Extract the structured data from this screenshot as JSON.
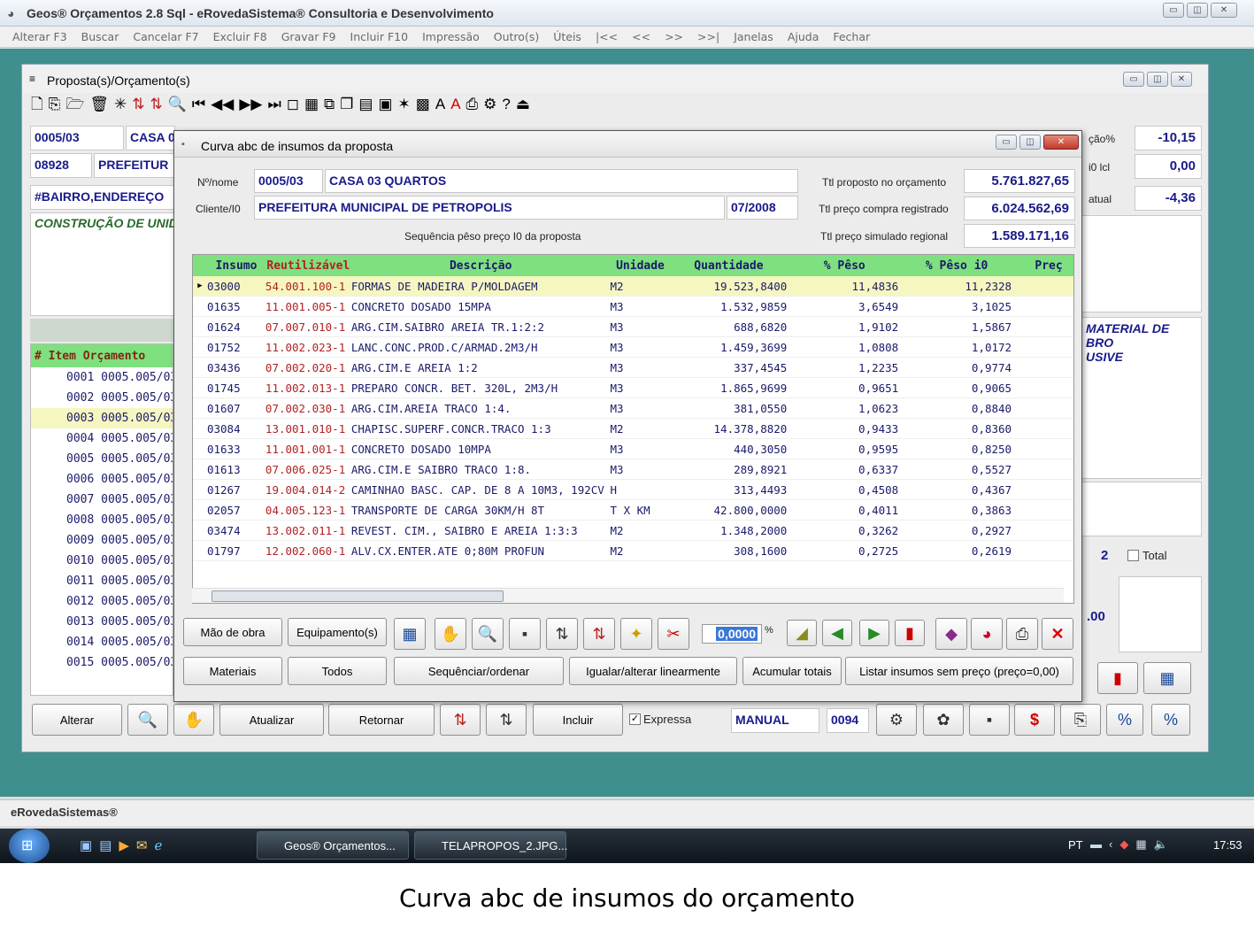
{
  "app": {
    "title": "Geos® Orçamentos 2.8 Sql - eRovedaSistema® Consultoria e Desenvolvimento"
  },
  "menu": [
    "Alterar F3",
    "Buscar",
    "Cancelar F7",
    "Excluir F8",
    "Gravar F9",
    "Incluir F10",
    "Impressão",
    "Outro(s)",
    "Úteis",
    "|<<",
    "<<",
    ">>",
    ">>|",
    "Janelas",
    "Ajuda",
    "Fechar"
  ],
  "proposal": {
    "title": "Proposta(s)/Orçamento(s)",
    "code": "0005/03",
    "name": "CASA 0",
    "client_code": "08928",
    "client_name": "PREFEITUR",
    "address": "#BAIRRO,ENDEREÇO",
    "construction": "CONSTRUÇÃO DE UNID",
    "right_labels": [
      "ção%",
      "i0 lcl",
      "atual"
    ],
    "right_values": [
      "-10,15",
      "0,00",
      "-4,36"
    ],
    "note": "MATERIAL DE\nBRO\nUSIVE",
    "count": "2",
    "total_label": "Total",
    "partial_value": ".00",
    "items_header": "# Item Orçamento",
    "items": [
      {
        "item": "0001",
        "orc": "0005.005/03"
      },
      {
        "item": "0002",
        "orc": "0005.005/03"
      },
      {
        "item": "0003",
        "orc": "0005.005/03"
      },
      {
        "item": "0004",
        "orc": "0005.005/03"
      },
      {
        "item": "0005",
        "orc": "0005.005/03"
      },
      {
        "item": "0006",
        "orc": "0005.005/03"
      },
      {
        "item": "0007",
        "orc": "0005.005/03"
      },
      {
        "item": "0008",
        "orc": "0005.005/03"
      },
      {
        "item": "0009",
        "orc": "0005.005/03"
      },
      {
        "item": "0010",
        "orc": "0005.005/03"
      },
      {
        "item": "0011",
        "orc": "0005.005/03"
      },
      {
        "item": "0012",
        "orc": "0005.005/03"
      },
      {
        "item": "0013",
        "orc": "0005.005/03"
      },
      {
        "item": "0014",
        "orc": "0005.005/03"
      },
      {
        "item": "0015",
        "orc": "0005.005/03"
      }
    ],
    "bottom": {
      "alterar": "Alterar",
      "atualizar": "Atualizar",
      "retornar": "Retornar",
      "incluir": "Incluir",
      "expressa": "Expressa",
      "manual": "MANUAL",
      "num": "0094"
    }
  },
  "dialog": {
    "title": "Curva abc de insumos da proposta",
    "nome_label": "Nº/nome",
    "code": "0005/03",
    "name": "CASA 03 QUARTOS",
    "cliente_label": "Cliente/I0",
    "client": "PREFEITURA MUNICIPAL DE PETROPOLIS",
    "date": "07/2008",
    "sequence_label": "Sequência pêso preço I0 da proposta",
    "totals": [
      {
        "label": "Ttl proposto no orçamento",
        "value": "5.761.827,65"
      },
      {
        "label": "Ttl preço compra registrado",
        "value": "6.024.562,69"
      },
      {
        "label": "Ttl preço simulado regional",
        "value": "1.589.171,16"
      }
    ],
    "columns": [
      "Insumo",
      "Reutilizável",
      "Descrição",
      "Unidade",
      "Quantidade",
      "% Pêso",
      "% Pêso i0",
      "Preç"
    ],
    "rows": [
      [
        "03000",
        "54.001.100-1",
        "FORMAS DE MADEIRA P/MOLDAGEM",
        "M2",
        "19.523,8400",
        "11,4836",
        "11,2328"
      ],
      [
        "01635",
        "11.001.005-1",
        "CONCRETO DOSADO 15MPA",
        "M3",
        "1.532,9859",
        "3,6549",
        "3,1025"
      ],
      [
        "01624",
        "07.007.010-1",
        "ARG.CIM.SAIBRO AREIA TR.1:2:2",
        "M3",
        "688,6820",
        "1,9102",
        "1,5867"
      ],
      [
        "01752",
        "11.002.023-1",
        "LANC.CONC.PROD.C/ARMAD.2M3/H",
        "M3",
        "1.459,3699",
        "1,0808",
        "1,0172"
      ],
      [
        "03436",
        "07.002.020-1",
        "ARG.CIM.E AREIA 1:2",
        "M3",
        "337,4545",
        "1,2235",
        "0,9774"
      ],
      [
        "01745",
        "11.002.013-1",
        "PREPARO CONCR. BET. 320L, 2M3/H",
        "M3",
        "1.865,9699",
        "0,9651",
        "0,9065"
      ],
      [
        "01607",
        "07.002.030-1",
        "ARG.CIM.AREIA TRACO 1:4.",
        "M3",
        "381,0550",
        "1,0623",
        "0,8840"
      ],
      [
        "03084",
        "13.001.010-1",
        "CHAPISC.SUPERF.CONCR.TRACO 1:3",
        "M2",
        "14.378,8820",
        "0,9433",
        "0,8360"
      ],
      [
        "01633",
        "11.001.001-1",
        "CONCRETO DOSADO 10MPA",
        "M3",
        "440,3050",
        "0,9595",
        "0,8250"
      ],
      [
        "01613",
        "07.006.025-1",
        "ARG.CIM.E SAIBRO TRACO 1:8.",
        "M3",
        "289,8921",
        "0,6337",
        "0,5527"
      ],
      [
        "01267",
        "19.004.014-2",
        "CAMINHAO BASC. CAP. DE 8 A 10M3, 192CV",
        "H",
        "313,4493",
        "0,4508",
        "0,4367"
      ],
      [
        "02057",
        "04.005.123-1",
        "TRANSPORTE DE CARGA 30KM/H 8T",
        "T X KM",
        "42.800,0000",
        "0,4011",
        "0,3863"
      ],
      [
        "03474",
        "13.002.011-1",
        "REVEST. CIM., SAIBRO E AREIA 1:3:3",
        "M2",
        "1.348,2000",
        "0,3262",
        "0,2927"
      ],
      [
        "01797",
        "12.002.060-1",
        "ALV.CX.ENTER.ATE 0;80M PROFUN",
        "M2",
        "308,1600",
        "0,2725",
        "0,2619"
      ]
    ],
    "buttons_row1": {
      "mao": "Mão de obra",
      "equip": "Equipamento(s)",
      "percent": "0,0000",
      "pct_sign": "%"
    },
    "buttons_row2": [
      "Materiais",
      "Todos",
      "Sequênciar/ordenar",
      "Igualar/alterar linearmente",
      "Acumular totais",
      "Listar insumos sem preço (preço=0,00)"
    ]
  },
  "statusbar": "eRovedaSistemas®",
  "taskbar": {
    "tasks": [
      "Geos® Orçamentos...",
      "TELAPROPOS_2.JPG..."
    ],
    "lang": "PT",
    "time": "17:53"
  },
  "caption": "Curva abc de insumos do orçamento"
}
